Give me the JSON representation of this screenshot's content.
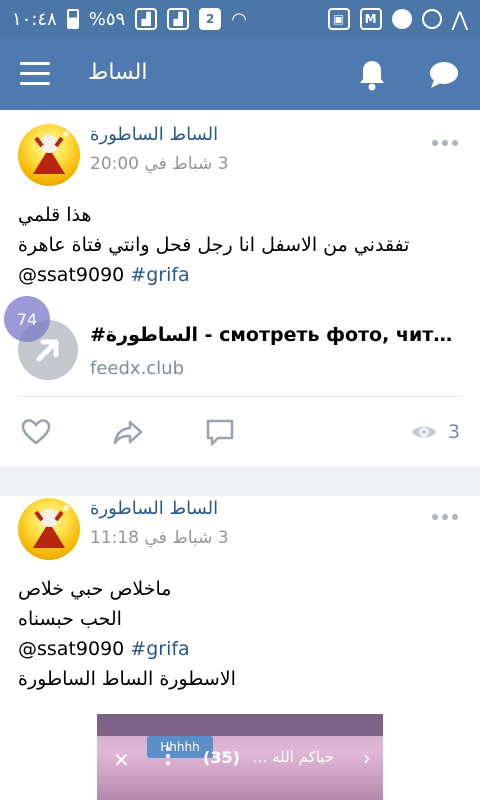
{
  "status": {
    "time": "١٠:٤٨",
    "battery": "%٥٩",
    "sim": "2"
  },
  "appbar": {
    "title": "الساط"
  },
  "posts": [
    {
      "author": "الساط الساطورة",
      "date": "3 شباط في 20:00",
      "lines": [
        "هذا قلمي",
        "تفقدني من الاسفل انا رجل فحل وانتي فتاة عاهرة"
      ],
      "mention": "@ssat9090",
      "hashtag": "#grifa",
      "link": {
        "title": "#الساطورة - смотреть фото, читать посты",
        "domain": "feedx.club"
      },
      "views": "3"
    },
    {
      "author": "الساط الساطورة",
      "date": "3 شباط في 11:18",
      "lines": [
        "ماخلاص حبي خلاص",
        "الحب حبسناه"
      ],
      "mention": "@ssat9090",
      "hashtag": "#grifa",
      "last_line": "الاسطورة الساط الساطورة",
      "image": {
        "tag": "Hhhhh",
        "count": "(35)",
        "title": "حياكم الله ..."
      }
    }
  ],
  "floating_badge": "74",
  "colors": {
    "header": "#4f7ab0",
    "statusbar": "#4a76a8",
    "link": "#2a5885",
    "meta": "#939699"
  }
}
